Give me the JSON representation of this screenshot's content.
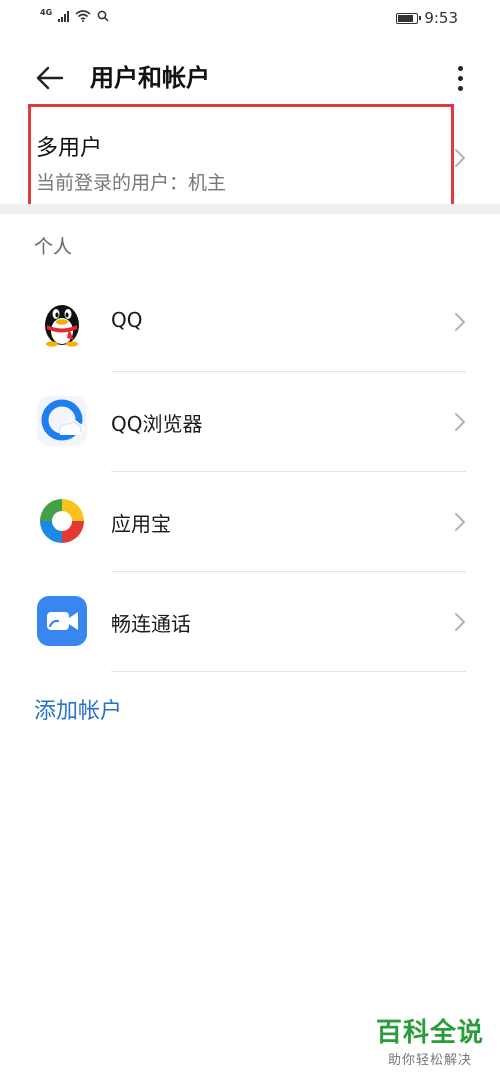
{
  "status_bar": {
    "network": "4G",
    "time": "9:53",
    "battery_level": 0.85
  },
  "header": {
    "title": "用户和帐户"
  },
  "multi_user": {
    "title": "多用户",
    "subtitle": "当前登录的用户：机主"
  },
  "section": {
    "personal_label": "个人"
  },
  "accounts": [
    {
      "name": "QQ",
      "icon": "qq-penguin-icon"
    },
    {
      "name": "QQ浏览器",
      "icon": "qq-browser-icon"
    },
    {
      "name": "应用宝",
      "icon": "app-store-icon"
    },
    {
      "name": "畅连通话",
      "icon": "video-call-icon"
    }
  ],
  "add_account": {
    "label": "添加帐户"
  },
  "colors": {
    "accent": "#2a72c9",
    "highlight": "#e0393e",
    "watermark": "#2a9d3a"
  },
  "watermark": {
    "title": "百科全说",
    "subtitle": "助你轻松解决"
  }
}
